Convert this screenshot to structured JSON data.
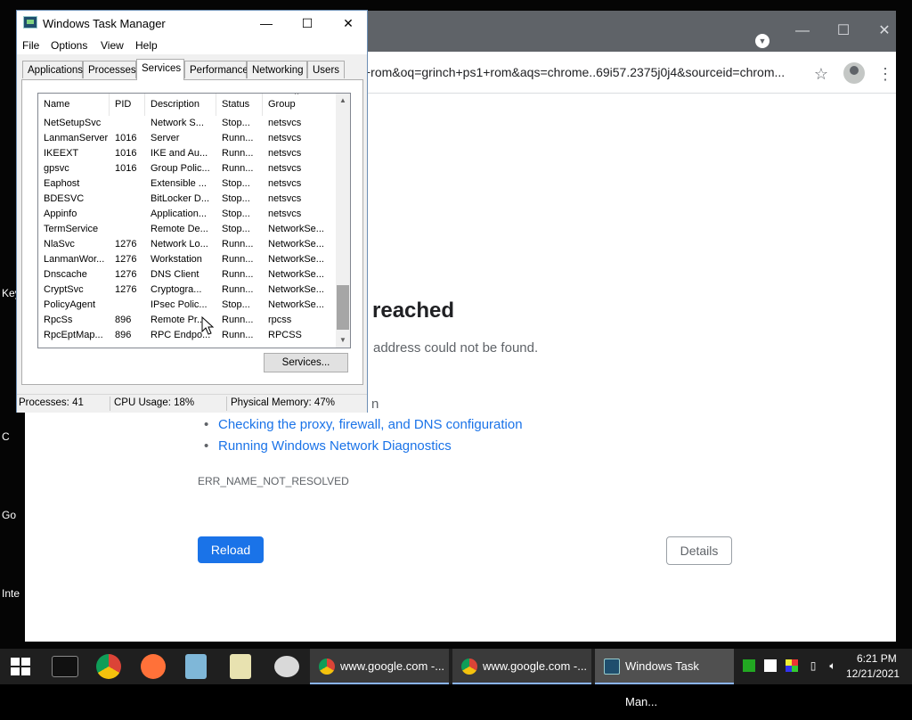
{
  "desktop": {
    "labels": [
      "Key",
      "C",
      "Go",
      "Inte"
    ]
  },
  "browser": {
    "url": "+rom&oq=grinch+ps1+rom&aqs=chrome..69i57.2375j0j4&sourceid=chrom...",
    "error": {
      "heading": "reached",
      "subtext": "address could not be found.",
      "try_fragment": "n",
      "suggestions": [
        "Checking the proxy, firewall, and DNS configuration",
        "Running Windows Network Diagnostics"
      ],
      "code": "ERR_NAME_NOT_RESOLVED"
    },
    "reload_label": "Reload",
    "details_label": "Details",
    "accent": "#1a73e8"
  },
  "task_manager": {
    "title": "Windows Task Manager",
    "menu": [
      "File",
      "Options",
      "View",
      "Help"
    ],
    "tabs": [
      "Applications",
      "Processes",
      "Services",
      "Performance",
      "Networking",
      "Users"
    ],
    "active_tab": "Services",
    "columns": [
      "Name",
      "PID",
      "Description",
      "Status",
      "Group"
    ],
    "rows": [
      [
        "NetSetupSvc",
        "",
        "Network S...",
        "Stop...",
        "netsvcs"
      ],
      [
        "LanmanServer",
        "1016",
        "Server",
        "Runn...",
        "netsvcs"
      ],
      [
        "IKEEXT",
        "1016",
        "IKE and Au...",
        "Runn...",
        "netsvcs"
      ],
      [
        "gpsvc",
        "1016",
        "Group Polic...",
        "Runn...",
        "netsvcs"
      ],
      [
        "Eaphost",
        "",
        "Extensible ...",
        "Stop...",
        "netsvcs"
      ],
      [
        "BDESVC",
        "",
        "BitLocker D...",
        "Stop...",
        "netsvcs"
      ],
      [
        "Appinfo",
        "",
        "Application...",
        "Stop...",
        "netsvcs"
      ],
      [
        "TermService",
        "",
        "Remote De...",
        "Stop...",
        "NetworkSe..."
      ],
      [
        "NlaSvc",
        "1276",
        "Network Lo...",
        "Runn...",
        "NetworkSe..."
      ],
      [
        "LanmanWor...",
        "1276",
        "Workstation",
        "Runn...",
        "NetworkSe..."
      ],
      [
        "Dnscache",
        "1276",
        "DNS Client",
        "Runn...",
        "NetworkSe..."
      ],
      [
        "CryptSvc",
        "1276",
        "Cryptogra...",
        "Runn...",
        "NetworkSe..."
      ],
      [
        "PolicyAgent",
        "",
        "IPsec Polic...",
        "Stop...",
        "NetworkSe..."
      ],
      [
        "RpcSs",
        "896",
        "Remote Pr...",
        "Runn...",
        "rpcss"
      ],
      [
        "RpcEptMap...",
        "896",
        "RPC Endpo...",
        "Runn...",
        "RPCSS"
      ]
    ],
    "services_button": "Services...",
    "status": {
      "processes": "Processes: 41",
      "cpu": "CPU Usage: 18%",
      "memory": "Physical Memory: 47%"
    }
  },
  "taskbar": {
    "tasks": [
      {
        "label": "www.google.com -..."
      },
      {
        "label": "www.google.com -..."
      },
      {
        "label": "Windows Task Man..."
      }
    ],
    "clock_time": "6:21 PM",
    "clock_date": "12/21/2021"
  }
}
